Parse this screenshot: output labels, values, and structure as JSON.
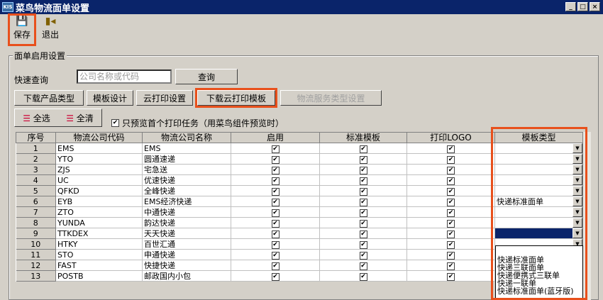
{
  "window": {
    "logo": "KIS",
    "title": "菜鸟物流面单设置"
  },
  "toolbar": {
    "save": "保存",
    "exit": "退出"
  },
  "group": {
    "title": "面单启用设置"
  },
  "search": {
    "label": "快速查询",
    "placeholder": "公司名称或代码",
    "button": "查询"
  },
  "buttons": {
    "download_product": "下载产品类型",
    "template_design": "模板设计",
    "cloud_print": "云打印设置",
    "download_template": "下载云打印模板",
    "service_type": "物流服务类型设置"
  },
  "select_all": "全选",
  "clear_all": "全清",
  "preview_only_first": {
    "label": "只预览首个打印任务（用菜鸟组件预览时）",
    "checked": true
  },
  "columns": [
    "序号",
    "物流公司代码",
    "物流公司名称",
    "启用",
    "标准模板",
    "打印LOGO",
    "模板类型"
  ],
  "rows": [
    {
      "seq": "1",
      "code": "EMS",
      "name": "EMS",
      "type": ""
    },
    {
      "seq": "2",
      "code": "YTO",
      "name": "圆通速递",
      "type": ""
    },
    {
      "seq": "3",
      "code": "ZJS",
      "name": "宅急送",
      "type": ""
    },
    {
      "seq": "4",
      "code": "UC",
      "name": "优速快递",
      "type": ""
    },
    {
      "seq": "5",
      "code": "QFKD",
      "name": "全峰快递",
      "type": ""
    },
    {
      "seq": "6",
      "code": "EYB",
      "name": "EMS经济快递",
      "type": "快递标准面单"
    },
    {
      "seq": "7",
      "code": "ZTO",
      "name": "中通快递",
      "type": ""
    },
    {
      "seq": "8",
      "code": "YUNDA",
      "name": "韵达快递",
      "type": ""
    },
    {
      "seq": "9",
      "code": "TTKDEX",
      "name": "天天快递",
      "type": ""
    },
    {
      "seq": "10",
      "code": "HTKY",
      "name": "百世汇通",
      "type": ""
    },
    {
      "seq": "11",
      "code": "STO",
      "name": "申通快递",
      "type": ""
    },
    {
      "seq": "12",
      "code": "FAST",
      "name": "快捷快递",
      "type": ""
    },
    {
      "seq": "13",
      "code": "POSTB",
      "name": "邮政国内小包",
      "type": ""
    }
  ],
  "dropdown_options": [
    "快递标准面单",
    "快递三联面单",
    "快递便携式三联单",
    "快递一联单",
    "快递标准面单(蓝牙版)"
  ],
  "colors": {
    "highlight": "#e8501c",
    "titlebar": "#0a246a"
  }
}
